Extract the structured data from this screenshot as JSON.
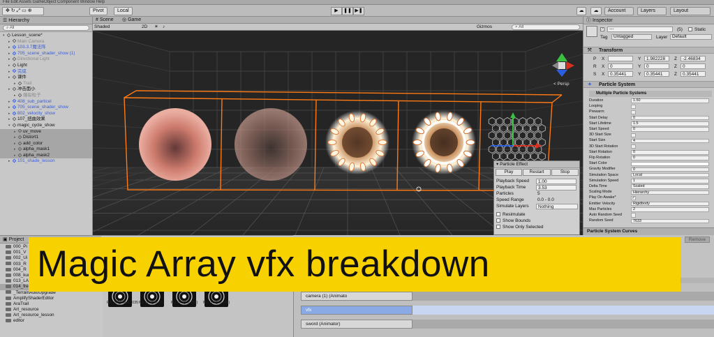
{
  "menubar": {
    "text": "File  Edit  Assets  GameObject  Component  Window  Help"
  },
  "toolbar": {
    "pivot": "Pivot",
    "local": "Local",
    "play": "▶",
    "pause": "❚❚",
    "step": "▶❚",
    "account": "Account",
    "layers": "Layers",
    "layout": "Layout"
  },
  "hierarchy": {
    "tab": "Hierarchy",
    "search": "All",
    "items": [
      {
        "label": "Lesson_scene*",
        "style": ""
      },
      {
        "label": "Main Camera",
        "style": "gray"
      },
      {
        "label": "103.3.7魔法阵",
        "style": "blue"
      },
      {
        "label": "705_scene_shader_show (1)",
        "style": "blue"
      },
      {
        "label": "Directional Light",
        "style": "gray"
      },
      {
        "label": "Light",
        "style": ""
      },
      {
        "label": "完成",
        "style": "blue"
      },
      {
        "label": "课件",
        "style": ""
      },
      {
        "label": "Trail",
        "style": "gray"
      },
      {
        "label": "冲击面小",
        "style": ""
      },
      {
        "label": "爆裂粒子",
        "style": "gray"
      },
      {
        "label": "408_sub_particel",
        "style": "blue"
      },
      {
        "label": "705_scene_shader_show",
        "style": "blue"
      },
      {
        "label": "802_velocity_show",
        "style": "blue"
      },
      {
        "label": "107_扭曲效果",
        "style": ""
      },
      {
        "label": "magic_cycle_show",
        "style": ""
      },
      {
        "label": "uv_move",
        "style": "sel"
      },
      {
        "label": "Distort1",
        "style": "sel"
      },
      {
        "label": "add_color",
        "style": "sel"
      },
      {
        "label": "alpha_mask1",
        "style": "sel"
      },
      {
        "label": "alpha_mask2",
        "style": "sel"
      },
      {
        "label": "101_shade_lesson",
        "style": "blue"
      }
    ]
  },
  "scene": {
    "tab_scene": "Scene",
    "tab_game": "Game",
    "shading": "Shaded",
    "mode2d": "2D",
    "gizmos": "Gizmos",
    "search": "All",
    "persp": "< Persp"
  },
  "particle_effect": {
    "title": "Particle Effect",
    "play": "Play",
    "restart": "Restart",
    "stop": "Stop",
    "rows": [
      {
        "label": "Playback Speed",
        "value": "1.00"
      },
      {
        "label": "Playback Time",
        "value": "3.53"
      },
      {
        "label": "Particles",
        "value": "5"
      },
      {
        "label": "Speed Range",
        "value": "0.0 - 0.0"
      },
      {
        "label": "Simulate Layers",
        "value": "Nothing"
      }
    ],
    "checks": [
      "Resimulate",
      "Show Bounds",
      "Show Only Selected"
    ]
  },
  "inspector": {
    "tab": "Inspector",
    "name": "---",
    "static": "Static",
    "tag_label": "Tag",
    "tag": "Untagged",
    "layer_label": "Layer",
    "layer": "Default",
    "count": "(5)",
    "transform": "Transform",
    "position": {
      "label": "P",
      "x": "",
      "y": "1.982228",
      "z": "-2.46834"
    },
    "rotation": {
      "label": "R",
      "x": "0",
      "y": "0",
      "z": "0"
    },
    "scale": {
      "label": "S",
      "x": "0.35441",
      "y": "0.35441",
      "z": "0.35441"
    },
    "particle_system": "Particle System",
    "multiple": "Multiple Particle Systems",
    "props": [
      {
        "label": "Duration",
        "value": "1.50"
      },
      {
        "label": "Looping",
        "value": ""
      },
      {
        "label": "Prewarm",
        "value": ""
      },
      {
        "label": "Start Delay",
        "value": "0"
      },
      {
        "label": "Start Lifetime",
        "value": "1.5"
      },
      {
        "label": "Start Speed",
        "value": "0"
      },
      {
        "label": "3D Start Size",
        "value": ""
      },
      {
        "label": "Start Size",
        "value": "4"
      },
      {
        "label": "3D Start Rotation",
        "value": ""
      },
      {
        "label": "Start Rotation",
        "value": "0"
      },
      {
        "label": "Flip Rotation",
        "value": "0"
      },
      {
        "label": "Start Color",
        "value": ""
      },
      {
        "label": "Gravity Modifier",
        "value": "0"
      },
      {
        "label": "Simulation Space",
        "value": "Local"
      },
      {
        "label": "Simulation Speed",
        "value": "1"
      },
      {
        "label": "Delta Time",
        "value": "Scaled"
      },
      {
        "label": "Scaling Mode",
        "value": "Hierarchy"
      },
      {
        "label": "Play On Awake*",
        "value": "✓"
      },
      {
        "label": "Emitter Velocity",
        "value": "Rigidbody"
      },
      {
        "label": "Max Particles",
        "value": "2"
      },
      {
        "label": "Auto Random Seed",
        "value": ""
      },
      {
        "label": "Random Seed",
        "value": "7633"
      }
    ],
    "curves": "Particle System Curves",
    "remove": "Remove"
  },
  "project": {
    "tab": "Project",
    "folders": [
      "000_Pi",
      "001_V",
      "002_Ui",
      "003_R",
      "004_R",
      "008_kuro",
      "013_LA",
      "014_free_lesson",
      "_TerrainAutoUpgrade",
      "AmplifyShaderEditor",
      "AraTrail",
      "Art_resource",
      "Art_resource_lesson",
      "editor"
    ],
    "thumbs": [
      {
        "label": "FX_skl_mask_035"
      },
      {
        "label": "My Images (2)"
      },
      {
        "label": "My Images (39)"
      },
      {
        "label": "My Images (44)"
      }
    ]
  },
  "timeline": {
    "tracks": [
      {
        "label": "camera (1) (Animato",
        "vfx": false
      },
      {
        "label": "vfx",
        "vfx": true
      },
      {
        "label": "sword (Animator)",
        "vfx": false
      }
    ]
  },
  "banner": {
    "text": "Magic Array vfx breakdown"
  },
  "colors": {
    "banner_bg": "#f7d100",
    "selection_orange": "#ff7a14",
    "blue_object": "#3a5cd6"
  }
}
